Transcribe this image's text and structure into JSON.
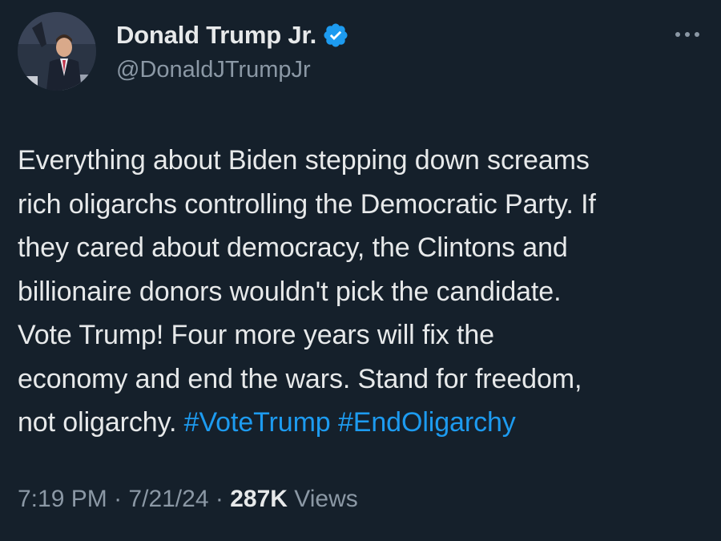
{
  "author": {
    "display_name": "Donald Trump Jr.",
    "handle": "@DonaldJTrumpJr",
    "verified_icon": "verified-badge-icon",
    "avatar_icon": "profile-photo"
  },
  "more_menu": {
    "icon": "more-options-icon"
  },
  "tweet": {
    "lines": [
      "Everything about Biden stepping down screams",
      "rich oligarchs controlling the Democratic Party. If",
      "they cared about democracy, the Clintons and",
      "billionaire donors wouldn't pick the candidate.",
      "Vote Trump! Four more years will fix the",
      "economy and end the wars. Stand for freedom,"
    ],
    "last_line_text": "not oligarchy. ",
    "hashtags": [
      "#VoteTrump",
      "#EndOligarchy"
    ]
  },
  "meta": {
    "time": "7:19 PM",
    "separator": "·",
    "date": "7/21/24",
    "views_count": "287K",
    "views_label": "Views"
  },
  "colors": {
    "background": "#15202b",
    "text": "#e7e9ea",
    "secondary": "#8b98a5",
    "accent": "#1d9bf0"
  }
}
